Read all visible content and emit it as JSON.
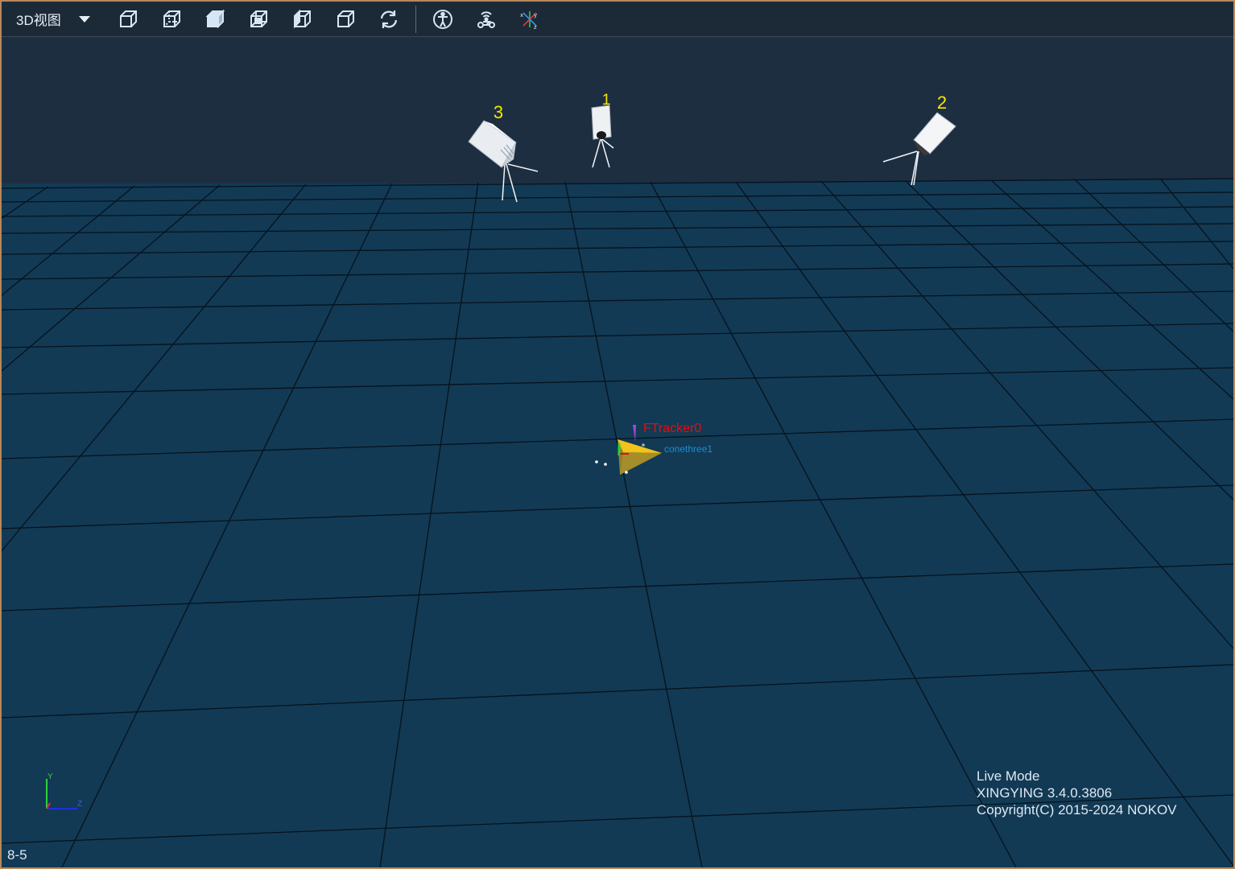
{
  "toolbar": {
    "view_select_label": "3D视图",
    "buttons": [
      {
        "icon": "view-cube-front-icon"
      },
      {
        "icon": "view-cube-top-icon"
      },
      {
        "icon": "view-cube-solid-icon"
      },
      {
        "icon": "view-cube-wire-icon"
      },
      {
        "icon": "view-cube-left-icon"
      },
      {
        "icon": "view-cube-right-icon"
      },
      {
        "icon": "refresh-icon"
      },
      {
        "icon": "skeleton-icon"
      },
      {
        "icon": "tracker-icon"
      },
      {
        "icon": "axis-xyz-icon"
      }
    ]
  },
  "scene": {
    "cameras": [
      {
        "label": "3"
      },
      {
        "label": "1"
      },
      {
        "label": "2"
      }
    ],
    "rigid_body": {
      "tracker_label": "FTracker0",
      "cone_label": "conethree1"
    },
    "axis_gizmo": {
      "y": "Y",
      "z": "Z"
    },
    "colors": {
      "floor": "#123a55",
      "wall": "#1e2e41",
      "grid": "#000000",
      "camera_label": "#f5e800",
      "tracker_label": "#e01010",
      "cone_label": "#1a8fd0"
    }
  },
  "status": {
    "mode": "Live Mode",
    "version": "XINGYING 3.4.0.3806",
    "copyright": "Copyright(C) 2015-2024 NOKOV",
    "corner": "8-5"
  }
}
